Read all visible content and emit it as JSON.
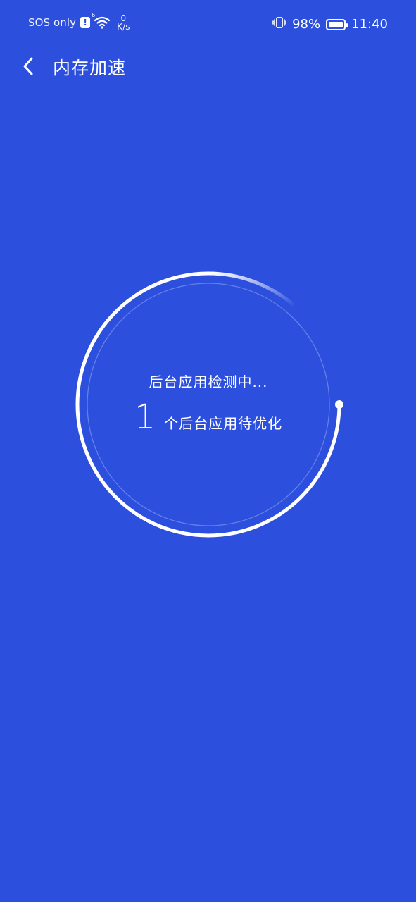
{
  "status_bar": {
    "carrier": "SOS only",
    "network_gen": "6",
    "net_speed_value": "0",
    "net_speed_unit": "K/s",
    "battery_percent": "98%",
    "battery_level": 0.98,
    "time": "11:40"
  },
  "header": {
    "title": "内存加速"
  },
  "scanner": {
    "status": "后台应用检测中...",
    "count": "1",
    "suffix": "个后台应用待优化",
    "progress": 0.92
  },
  "colors": {
    "background": "#2c4fdd",
    "foreground": "#ffffff"
  }
}
